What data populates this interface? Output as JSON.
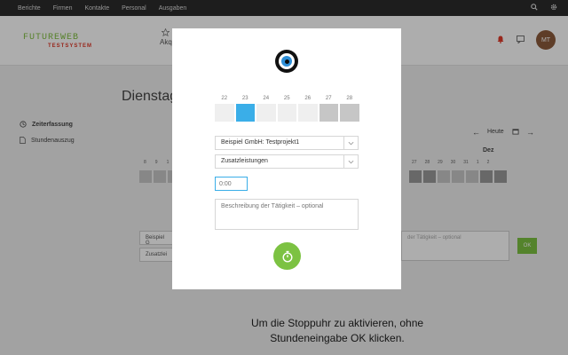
{
  "topnav": {
    "items": [
      "Berichte",
      "Firmen",
      "Kontakte",
      "Personal",
      "Ausgaben"
    ],
    "search_icon": "search-icon",
    "settings_icon": "gear-icon"
  },
  "header": {
    "logo_line1": "FUTUREWEB",
    "logo_line2": "TESTSYSTEM",
    "nav_partial_label": "Akq",
    "bell_icon": "bell-icon",
    "message_icon": "message-icon",
    "avatar_initials": "MT"
  },
  "page": {
    "title": "Dienstag",
    "sidebar": [
      {
        "icon": "clock-icon",
        "label": "Zeiterfassung"
      },
      {
        "icon": "document-icon",
        "label": "Stundenauszug"
      }
    ],
    "today_label": "Heute",
    "month_label": "Dez",
    "bg_left_nums": [
      "8",
      "9",
      "1"
    ],
    "bg_right_nums": [
      "27",
      "28",
      "29",
      "30",
      "31",
      "1",
      "2"
    ],
    "bg_field_project": "Beispiel G",
    "bg_field_service": "Zusatzlei",
    "bg_desc_placeholder": "der Tätigkeit – optional",
    "ok_label": "OK",
    "hint_text": "Um die Stoppuhr zu aktivieren, ohne Stundeneingabe OK klicken."
  },
  "modal": {
    "days": [
      {
        "num": "22",
        "state": "normal"
      },
      {
        "num": "23",
        "state": "selected"
      },
      {
        "num": "24",
        "state": "normal"
      },
      {
        "num": "25",
        "state": "normal"
      },
      {
        "num": "26",
        "state": "normal"
      },
      {
        "num": "27",
        "state": "weekend"
      },
      {
        "num": "28",
        "state": "weekend"
      }
    ],
    "project_value": "Beispiel GmbH: Testprojekt1",
    "service_value": "Zusatzleistungen",
    "time_placeholder": "0:00",
    "description_placeholder": "Beschreibung der Tätigkeit – optional",
    "stopwatch_icon": "stopwatch-icon"
  },
  "colors": {
    "accent_blue": "#3aaee8",
    "accent_green": "#7cc242",
    "logo_red": "#e03a2a",
    "nav_bg": "#2b2b2b"
  }
}
